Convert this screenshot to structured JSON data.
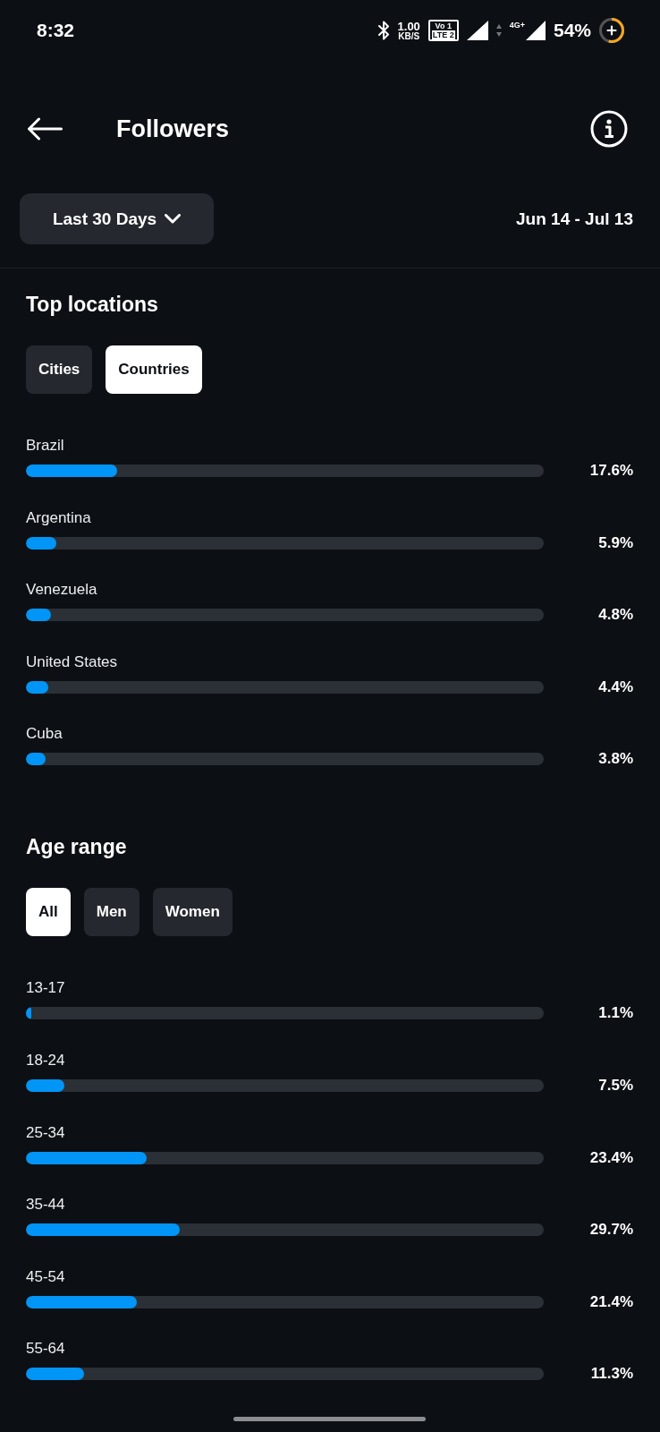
{
  "status_bar": {
    "time": "8:32",
    "network_speed": {
      "value": "1.00",
      "unit": "KB/S"
    },
    "volte": [
      "Vo 1",
      "LTE 2"
    ],
    "network_type": "4G+",
    "battery": "54%"
  },
  "header": {
    "title": "Followers"
  },
  "period": {
    "dropdown": "Last 30 Days",
    "range": "Jun 14 - Jul 13"
  },
  "sections": [
    {
      "title": "Top locations",
      "filters": [
        {
          "label": "Cities",
          "selected": false
        },
        {
          "label": "Countries",
          "selected": true
        }
      ],
      "rows": [
        {
          "label": "Brazil",
          "level": 0.176,
          "value": "17.6%"
        },
        {
          "label": "Argentina",
          "level": 0.059,
          "value": "5.9%"
        },
        {
          "label": "Venezuela",
          "level": 0.048,
          "value": "4.8%"
        },
        {
          "label": "United States",
          "level": 0.044,
          "value": "4.4%"
        },
        {
          "label": "Cuba",
          "level": 0.038,
          "value": "3.8%"
        }
      ]
    },
    {
      "title": "Age range",
      "filters": [
        {
          "label": "All",
          "selected": true
        },
        {
          "label": "Men",
          "selected": false
        },
        {
          "label": "Women",
          "selected": false
        }
      ],
      "rows": [
        {
          "label": "13-17",
          "level": 0.011,
          "value": "1.1%"
        },
        {
          "label": "18-24",
          "level": 0.075,
          "value": "7.5%"
        },
        {
          "label": "25-34",
          "level": 0.234,
          "value": "23.4%"
        },
        {
          "label": "35-44",
          "level": 0.297,
          "value": "29.7%"
        },
        {
          "label": "45-54",
          "level": 0.214,
          "value": "21.4%"
        },
        {
          "label": "55-64",
          "level": 0.113,
          "value": "11.3%"
        }
      ]
    }
  ]
}
